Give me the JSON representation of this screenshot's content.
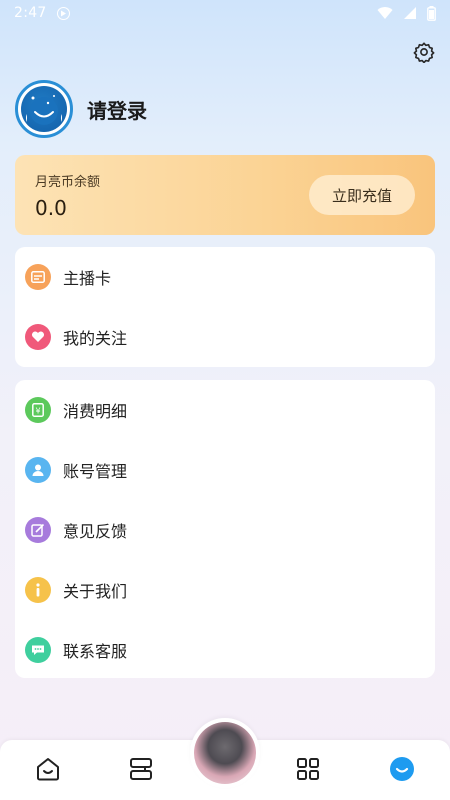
{
  "status_bar": {
    "time": "2:47"
  },
  "profile": {
    "login_label": "请登录"
  },
  "balance": {
    "label": "月亮币余额",
    "value": "0.0",
    "recharge_label": "立即充值"
  },
  "menu_group_1": [
    {
      "label": "主播卡",
      "icon": "card-icon",
      "color": "#f7a25a"
    },
    {
      "label": "我的关注",
      "icon": "heart-icon",
      "color": "#f0597a"
    }
  ],
  "menu_group_2": [
    {
      "label": "消费明细",
      "icon": "wallet-icon",
      "color": "#5cc95c"
    },
    {
      "label": "账号管理",
      "icon": "user-icon",
      "color": "#59b5f0"
    },
    {
      "label": "意见反馈",
      "icon": "edit-icon",
      "color": "#a77bdc"
    },
    {
      "label": "关于我们",
      "icon": "info-icon",
      "color": "#f6c24a"
    },
    {
      "label": "联系客服",
      "icon": "chat-icon",
      "color": "#3fcf9e"
    }
  ],
  "tabbar": {
    "tabs": [
      "home-icon",
      "library-icon",
      "player-avatar",
      "grid-icon",
      "profile-icon"
    ],
    "active_color": "#1e9bf0"
  }
}
